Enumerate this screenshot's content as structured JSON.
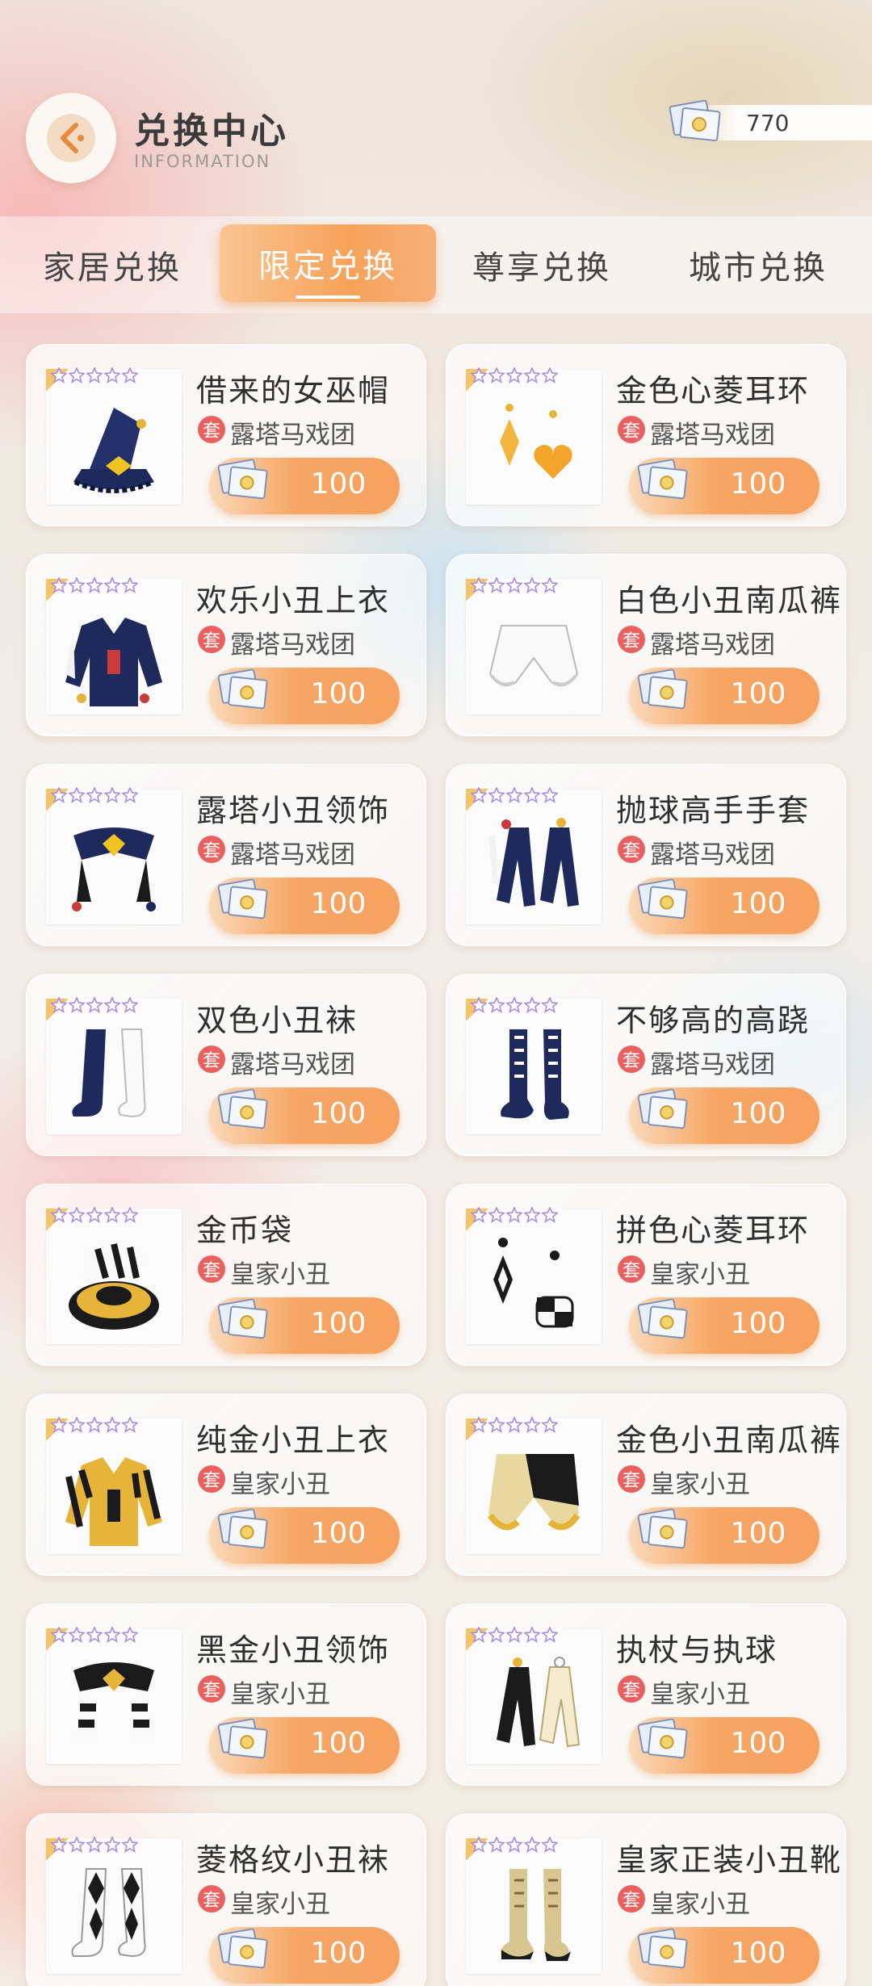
{
  "header": {
    "title": "兑换中心",
    "subtitle": "INFORMATION",
    "currency": "770"
  },
  "tabs": [
    {
      "label": "家居兑换",
      "active": false
    },
    {
      "label": "限定兑换",
      "active": true
    },
    {
      "label": "尊享兑换",
      "active": false
    },
    {
      "label": "城市兑换",
      "active": false
    }
  ],
  "items": [
    {
      "name": "借来的女巫帽",
      "badge": "套",
      "set": "露塔马戏团",
      "price": "100",
      "art": "witch-hat"
    },
    {
      "name": "金色心菱耳环",
      "badge": "套",
      "set": "露塔马戏团",
      "price": "100",
      "art": "gold-earrings"
    },
    {
      "name": "欢乐小丑上衣",
      "badge": "套",
      "set": "露塔马戏团",
      "price": "100",
      "art": "jacket-blue"
    },
    {
      "name": "白色小丑南瓜裤",
      "badge": "套",
      "set": "露塔马戏团",
      "price": "100",
      "art": "white-pants"
    },
    {
      "name": "露塔小丑领饰",
      "badge": "套",
      "set": "露塔马戏团",
      "price": "100",
      "art": "collar-blue"
    },
    {
      "name": "抛球高手手套",
      "badge": "套",
      "set": "露塔马戏团",
      "price": "100",
      "art": "gloves-blue"
    },
    {
      "name": "双色小丑袜",
      "badge": "套",
      "set": "露塔马戏团",
      "price": "100",
      "art": "socks-bicolor"
    },
    {
      "name": "不够高的高跷",
      "badge": "套",
      "set": "露塔马戏团",
      "price": "100",
      "art": "boots-blue"
    },
    {
      "name": "金币袋",
      "badge": "套",
      "set": "皇家小丑",
      "price": "100",
      "art": "coin-bag"
    },
    {
      "name": "拼色心菱耳环",
      "badge": "套",
      "set": "皇家小丑",
      "price": "100",
      "art": "checker-earrings"
    },
    {
      "name": "纯金小丑上衣",
      "badge": "套",
      "set": "皇家小丑",
      "price": "100",
      "art": "jacket-gold"
    },
    {
      "name": "金色小丑南瓜裤",
      "badge": "套",
      "set": "皇家小丑",
      "price": "100",
      "art": "gold-pants"
    },
    {
      "name": "黑金小丑领饰",
      "badge": "套",
      "set": "皇家小丑",
      "price": "100",
      "art": "collar-black"
    },
    {
      "name": "执杖与执球",
      "badge": "套",
      "set": "皇家小丑",
      "price": "100",
      "art": "gloves-pair"
    },
    {
      "name": "菱格纹小丑袜",
      "badge": "套",
      "set": "皇家小丑",
      "price": "100",
      "art": "socks-argyle"
    },
    {
      "name": "皇家正装小丑靴",
      "badge": "套",
      "set": "皇家小丑",
      "price": "100",
      "art": "boots-gold"
    }
  ],
  "colors": {
    "accent_orange": "#f7a25a",
    "set_badge": "#e9605f",
    "navy": "#1f2a5c",
    "gold": "#e7b43a"
  }
}
